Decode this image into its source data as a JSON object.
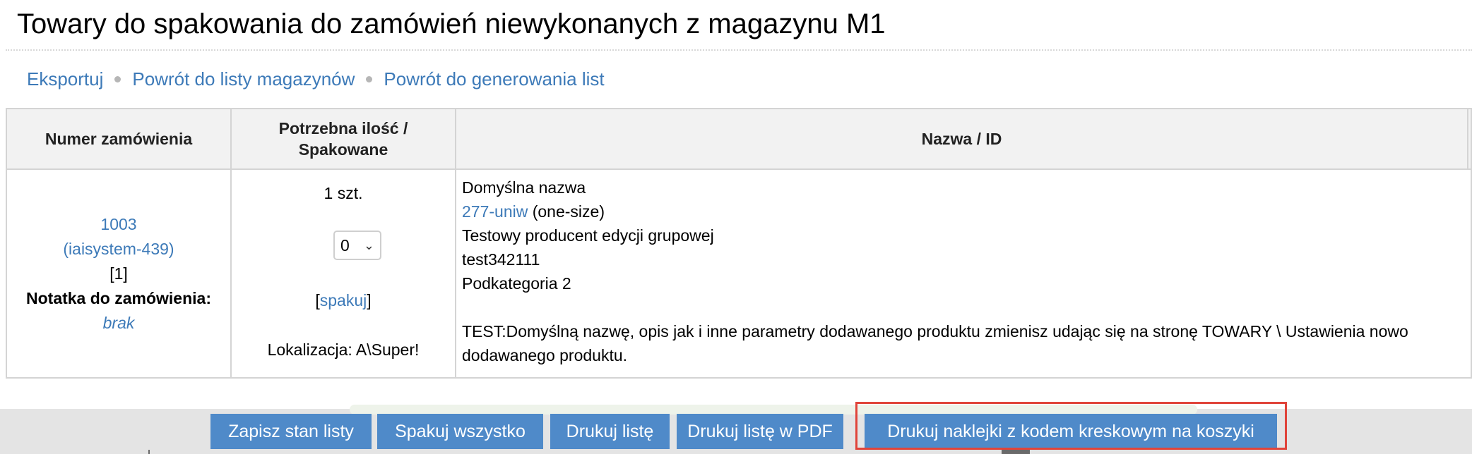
{
  "page": {
    "title": "Towary do spakowania do zamówień niewykonanych z magazynu M1"
  },
  "links": {
    "export": "Eksportuj",
    "back_to_warehouses": "Powrót do listy magazynów",
    "back_to_generation": "Powrót do generowania list"
  },
  "table": {
    "headers": {
      "order_number": "Numer zamówienia",
      "qty_line1": "Potrzebna ilość /",
      "qty_line2": "Spakowane",
      "name_id": "Nazwa / ID"
    },
    "row": {
      "order_id": "1003",
      "order_ref": "(iaisystem-439)",
      "order_count": "[1]",
      "note_label": "Notatka do zamówienia:",
      "note_value": "brak",
      "needed_qty": "1 szt.",
      "packed_select_value": "0",
      "pack_bracket_open": "[",
      "pack_link": "spakuj",
      "pack_bracket_close": "]",
      "location": "Lokalizacja: A\\Super!",
      "product_name": "Domyślna nazwa",
      "product_id_link": "277-uniw",
      "product_size": " (one-size)",
      "producer": "Testowy producent edycji grupowej",
      "code": "test342111",
      "category": "Podkategoria 2",
      "description": "TEST:Domyślną nazwę, opis jak i inne parametry dodawanego produktu zmienisz udając się na stronę TOWARY \\ Ustawienia nowo dodawanego produktu."
    }
  },
  "actions": {
    "save_state": "Zapisz stan listy",
    "pack_all": "Spakuj wszystko",
    "print_list": "Drukuj listę",
    "print_pdf": "Drukuj listę w PDF",
    "print_labels": "Drukuj naklejki z kodem kreskowym na koszyki"
  },
  "colors": {
    "link": "#3d7ab8",
    "button": "#4f8ac9",
    "highlight": "#e0443a"
  }
}
